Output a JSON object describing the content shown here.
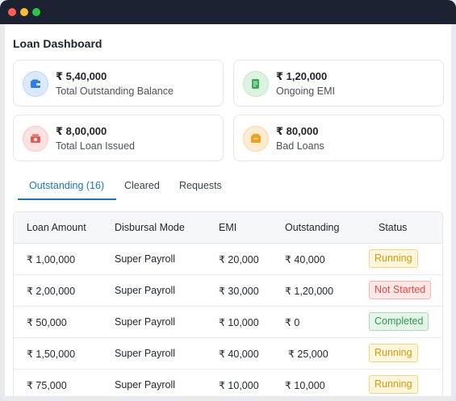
{
  "window": {
    "title": ""
  },
  "page": {
    "title": "Loan Dashboard"
  },
  "cards": [
    {
      "amount": "₹ 5,40,000",
      "label": "Total Outstanding Balance",
      "icon": "wallet-icon",
      "color": "#2f7fe0"
    },
    {
      "amount": "₹ 1,20,000",
      "label": "Ongoing EMI",
      "icon": "rupee-bill-icon",
      "color": "#3cad5a"
    },
    {
      "amount": "₹ 8,00,000",
      "label": "Total Loan Issued",
      "icon": "money-issued-icon",
      "color": "#e05a52"
    },
    {
      "amount": "₹ 80,000",
      "label": "Bad Loans",
      "icon": "bad-loan-icon",
      "color": "#f0a120"
    }
  ],
  "tabs": [
    {
      "label": "Outstanding (16)",
      "active": true
    },
    {
      "label": "Cleared",
      "active": false
    },
    {
      "label": "Requests",
      "active": false
    }
  ],
  "table": {
    "headers": [
      "Loan Amount",
      "Disbursal Mode",
      "EMI",
      "Outstanding",
      "Status"
    ],
    "rows": [
      {
        "amount": "₹ 1,00,000",
        "mode": "Super Payroll",
        "emi": "₹ 20,000",
        "outstanding": "₹ 40,000",
        "status": "Running"
      },
      {
        "amount": "₹ 2,00,000",
        "mode": "Super Payroll",
        "emi": "₹ 30,000",
        "outstanding": "₹ 1,20,000",
        "status": "Not Started"
      },
      {
        "amount": "₹ 50,000",
        "mode": "Super Payroll",
        "emi": "₹ 10,000",
        "outstanding": "₹ 0",
        "status": "Completed"
      },
      {
        "amount": "₹ 1,50,000",
        "mode": "Super Payroll",
        "emi": "₹ 40,000",
        "outstanding": "₹ 25,000",
        "status": "Running"
      },
      {
        "amount": "₹ 75,000",
        "mode": "Super Payroll",
        "emi": "₹ 10,000",
        "outstanding": "₹ 10,000",
        "status": "Running"
      }
    ]
  },
  "colors": {
    "accent": "#1977b8",
    "running": "#d39a06",
    "not_started": "#dc4a43",
    "completed": "#2f9a4a"
  }
}
